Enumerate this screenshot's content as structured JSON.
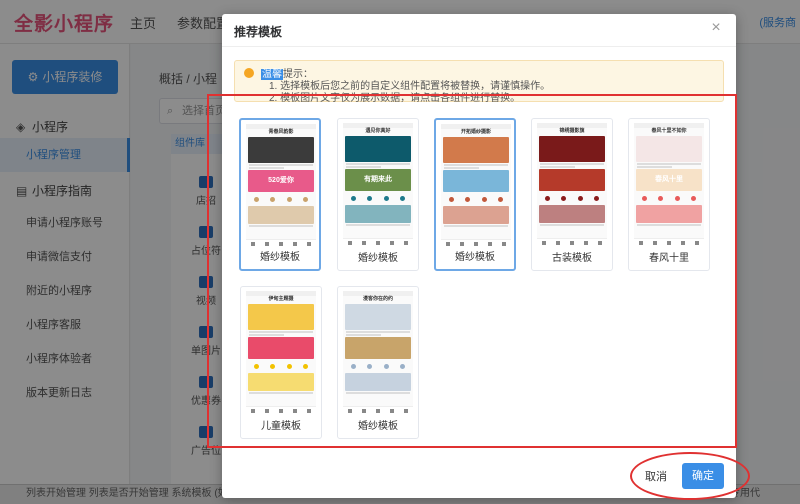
{
  "app": {
    "logo": "全影小程序",
    "nav": [
      "主页",
      "参数配置"
    ],
    "top_right": "(服务商"
  },
  "sidebar": {
    "primary_button": "小程序装修",
    "groups": [
      {
        "label": "小程序",
        "icon": "layers-icon"
      },
      {
        "label": "小程序指南",
        "icon": "book-icon"
      }
    ],
    "items": [
      "小程序管理",
      "申请小程序账号",
      "申请微信支付",
      "附近的小程序",
      "小程序客服",
      "小程序体验者",
      "版本更新日志"
    ]
  },
  "content": {
    "breadcrumb": "概括 / 小程",
    "search_placeholder": "选择首页",
    "components_tab": "组件库",
    "components": [
      "店招",
      "占位符",
      "视频",
      "单图片",
      "优惠券",
      "广告位"
    ]
  },
  "statusbar": {
    "left": "列表开始管理    列表是否开始管理    系统模板    (如不是自定",
    "right": "专用代"
  },
  "modal": {
    "title": "推荐模板",
    "close": "×",
    "tip": {
      "highlight": "温馨",
      "title_rest": "提示：",
      "lines": [
        "1. 选择模板后您之前的自定义组件配置将被替换，请谨慎操作。",
        "2. 模板图片文字仅为展示数据，请点击各组件进行替换。"
      ]
    },
    "templates": [
      {
        "label": "婚纱模板",
        "header": "青春风韵影",
        "selected": true,
        "accent": "#c9a26b",
        "hero": "#3b3b3b",
        "promo": "#e85a8a",
        "promo_text": "520爱你"
      },
      {
        "label": "婚纱模板",
        "header": "遇见你真好",
        "selected": false,
        "accent": "#1f7a8c",
        "hero": "#0d5a6b",
        "promo": "#6b8f4a",
        "promo_text": "有期来此"
      },
      {
        "label": "婚纱模板",
        "header": "开拓婚纱摄影",
        "selected": true,
        "accent": "#c2593b",
        "hero": "#d27a4b",
        "promo": "#7ab6d9",
        "promo_text": ""
      },
      {
        "label": "古装模板",
        "header": "锦绣摄影旗",
        "selected": false,
        "accent": "#8b1c1c",
        "hero": "#7a1a1a",
        "promo": "#b53a2a",
        "promo_text": ""
      },
      {
        "label": "春风十里",
        "header": "春风十里不如你",
        "selected": false,
        "accent": "#e85a5a",
        "hero": "#f4e6e6",
        "promo": "#f7e2c8",
        "promo_text": "春风十里"
      },
      {
        "label": "儿童模板",
        "header": "伊甸主题摄",
        "selected": false,
        "accent": "#f2c200",
        "hero": "#f4c84a",
        "promo": "#e94b6a",
        "promo_text": ""
      },
      {
        "label": "婚纱模板",
        "header": "漫客你在的约",
        "selected": false,
        "accent": "#9ab0c8",
        "hero": "#cfd9e3",
        "promo": "#c8a46a",
        "promo_text": ""
      }
    ],
    "cancel_label": "取消",
    "ok_label": "确定"
  }
}
